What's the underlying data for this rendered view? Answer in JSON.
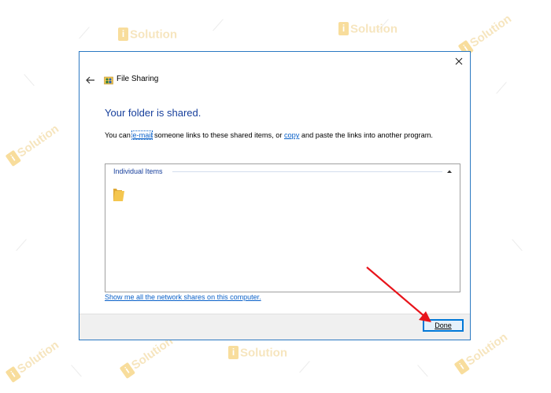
{
  "dialog": {
    "title": "File Sharing",
    "heading": "Your folder is shared.",
    "description": {
      "prefix": "You can ",
      "email_link": "e-mail",
      "middle": " someone links to these shared items, or ",
      "copy_link": "copy",
      "suffix": " and paste the links into another program."
    },
    "items_group": {
      "header": "Individual Items"
    },
    "network_link": "Show me all the network shares on this computer.",
    "done_label": "Done"
  },
  "watermark": {
    "word": "Solution",
    "badge": "i"
  },
  "colors": {
    "dialog_border": "#2b79c2",
    "heading": "#173f9c",
    "link": "#0a61c9",
    "done_border": "#0078d7",
    "arrow": "#e8141b",
    "folder": "#f4c64f"
  },
  "icons": {
    "close": "close-icon",
    "back": "back-arrow-icon",
    "app": "file-sharing-icon",
    "collapse": "chevron-up-icon",
    "folder": "folder-icon"
  }
}
